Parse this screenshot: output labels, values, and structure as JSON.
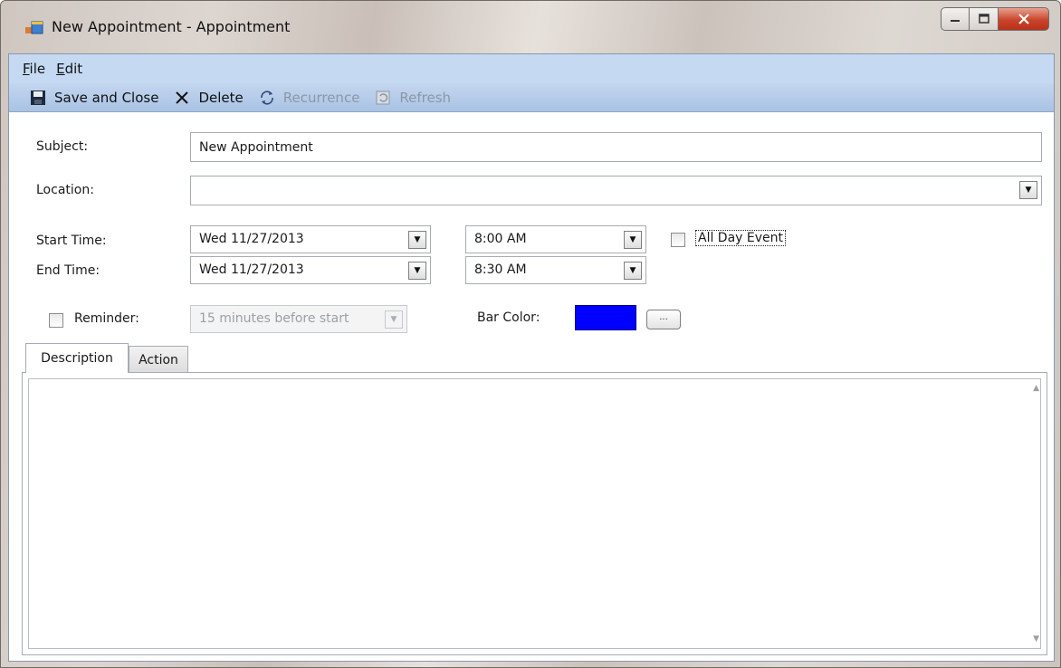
{
  "window": {
    "title": "New Appointment - Appointment"
  },
  "menu": [
    {
      "key": "F",
      "rest": "ile"
    },
    {
      "key": "E",
      "rest": "dit"
    }
  ],
  "toolbar": {
    "save_close": "Save and Close",
    "delete": "Delete",
    "recurrence": "Recurrence",
    "refresh": "Refresh"
  },
  "form": {
    "subject_label": "Subject:",
    "subject_value": "New Appointment",
    "location_label": "Location:",
    "location_value": "",
    "start_label": "Start Time:",
    "start_date": "Wed 11/27/2013",
    "start_time": "8:00 AM",
    "all_day_label": "All Day Event",
    "all_day_checked": false,
    "end_label": "End Time:",
    "end_date": "Wed 11/27/2013",
    "end_time": "8:30 AM",
    "reminder_label": "Reminder:",
    "reminder_checked": false,
    "reminder_value": "15 minutes before start",
    "bar_color_label": "Bar Color:",
    "bar_color": "#0000FF",
    "ellipsis": "..."
  },
  "tabs": [
    {
      "label": "Description",
      "active": true
    },
    {
      "label": "Action",
      "active": false
    }
  ],
  "description": ""
}
